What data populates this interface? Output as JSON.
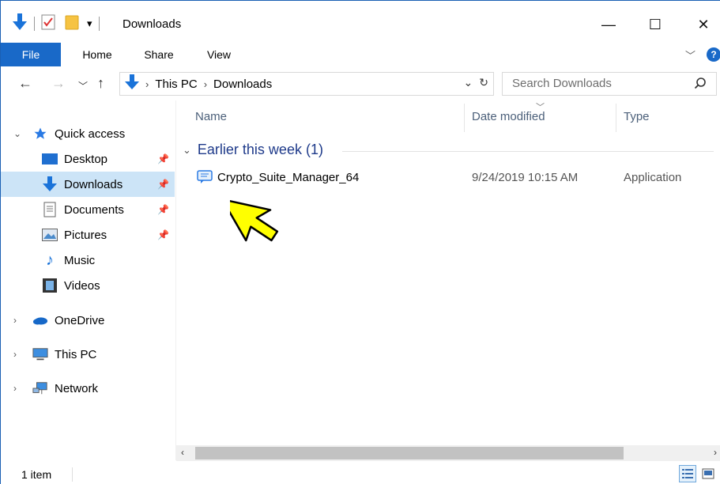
{
  "window": {
    "title": "Downloads",
    "qat_dropdown": "▾",
    "controls": {
      "minimize": "—",
      "maximize": "☐",
      "close": "✕"
    }
  },
  "ribbon": {
    "tabs": [
      {
        "label": "File"
      },
      {
        "label": "Home"
      },
      {
        "label": "Share"
      },
      {
        "label": "View"
      }
    ],
    "expand_icon": "chevron-down-icon",
    "help_label": "?"
  },
  "navigation": {
    "back_icon": "back-arrow-icon",
    "forward_icon": "forward-arrow-icon",
    "recent_icon": "chevron-down-icon",
    "up_icon": "up-arrow-icon",
    "breadcrumbs": [
      "This PC",
      "Downloads"
    ],
    "search_placeholder": "Search Downloads"
  },
  "nav_pane": {
    "quick_access": "Quick access",
    "items": [
      {
        "label": "Desktop",
        "pinned": true
      },
      {
        "label": "Downloads",
        "pinned": true,
        "selected": true
      },
      {
        "label": "Documents",
        "pinned": true
      },
      {
        "label": "Pictures",
        "pinned": true
      },
      {
        "label": "Music",
        "pinned": false
      },
      {
        "label": "Videos",
        "pinned": false
      }
    ],
    "roots": [
      {
        "label": "OneDrive"
      },
      {
        "label": "This PC"
      },
      {
        "label": "Network"
      }
    ]
  },
  "columns": {
    "name": "Name",
    "date": "Date modified",
    "type": "Type"
  },
  "group": {
    "label": "Earlier this week (1)"
  },
  "files": [
    {
      "name": "Crypto_Suite_Manager_64",
      "date": "9/24/2019 10:15 AM",
      "type": "Application"
    }
  ],
  "status": {
    "count": "1 item"
  },
  "colors": {
    "accent": "#1969c8",
    "selection": "#cce4f7",
    "group_text": "#1e3a8a",
    "cursor": "#ffff00"
  }
}
